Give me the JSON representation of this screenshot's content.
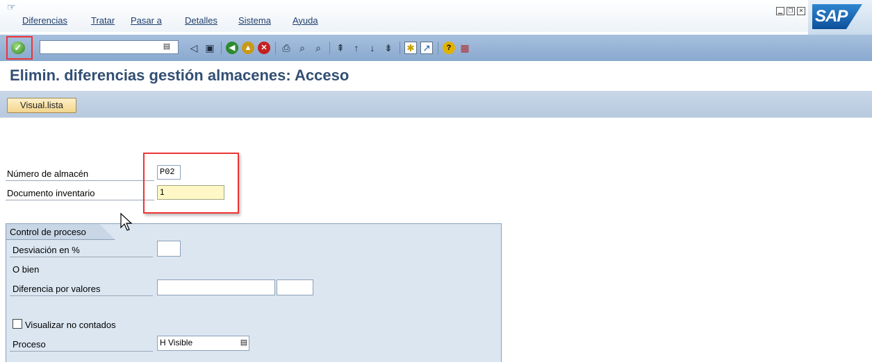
{
  "menubar": {
    "items": [
      "Diferencias",
      "Tratar",
      "Pasar a",
      "Detalles",
      "Sistema",
      "Ayuda"
    ]
  },
  "logo": {
    "text": "SAP"
  },
  "toolbar": {
    "command_value": "",
    "icons": [
      "enter-icon",
      "back-icon",
      "save-icon",
      "back-green-icon",
      "exit-icon",
      "cancel-icon",
      "print-icon",
      "find-icon",
      "find-next-icon",
      "first-page-icon",
      "prev-page-icon",
      "next-page-icon",
      "last-page-icon",
      "new-session-icon",
      "shortcut-icon",
      "help-icon",
      "layout-icon"
    ]
  },
  "page": {
    "title": "Elimin. diferencias gestión almacenes: Acceso"
  },
  "app_toolbar": {
    "visual_lista_label": "Visual.lista"
  },
  "form": {
    "almacen_label": "Número de almacén",
    "almacen_value": "P02",
    "documento_label": "Documento inventario",
    "documento_value": "1"
  },
  "group": {
    "title": "Control de proceso",
    "desviacion_label": "Desviación en %",
    "desviacion_value": "",
    "o_bien_label": "O bien",
    "diferencia_label": "Diferencia por valores",
    "diferencia_value": "",
    "diferencia_currency": "",
    "visualizar_label": "Visualizar no contados",
    "visualizar_checked": false,
    "proceso_label": "Proceso",
    "proceso_value": "H Visible"
  },
  "colors": {
    "toolbar_blue": "#a7c0de",
    "title_blue": "#324f73",
    "highlight_red": "#e33333",
    "required_yellow": "#fff8c6"
  }
}
